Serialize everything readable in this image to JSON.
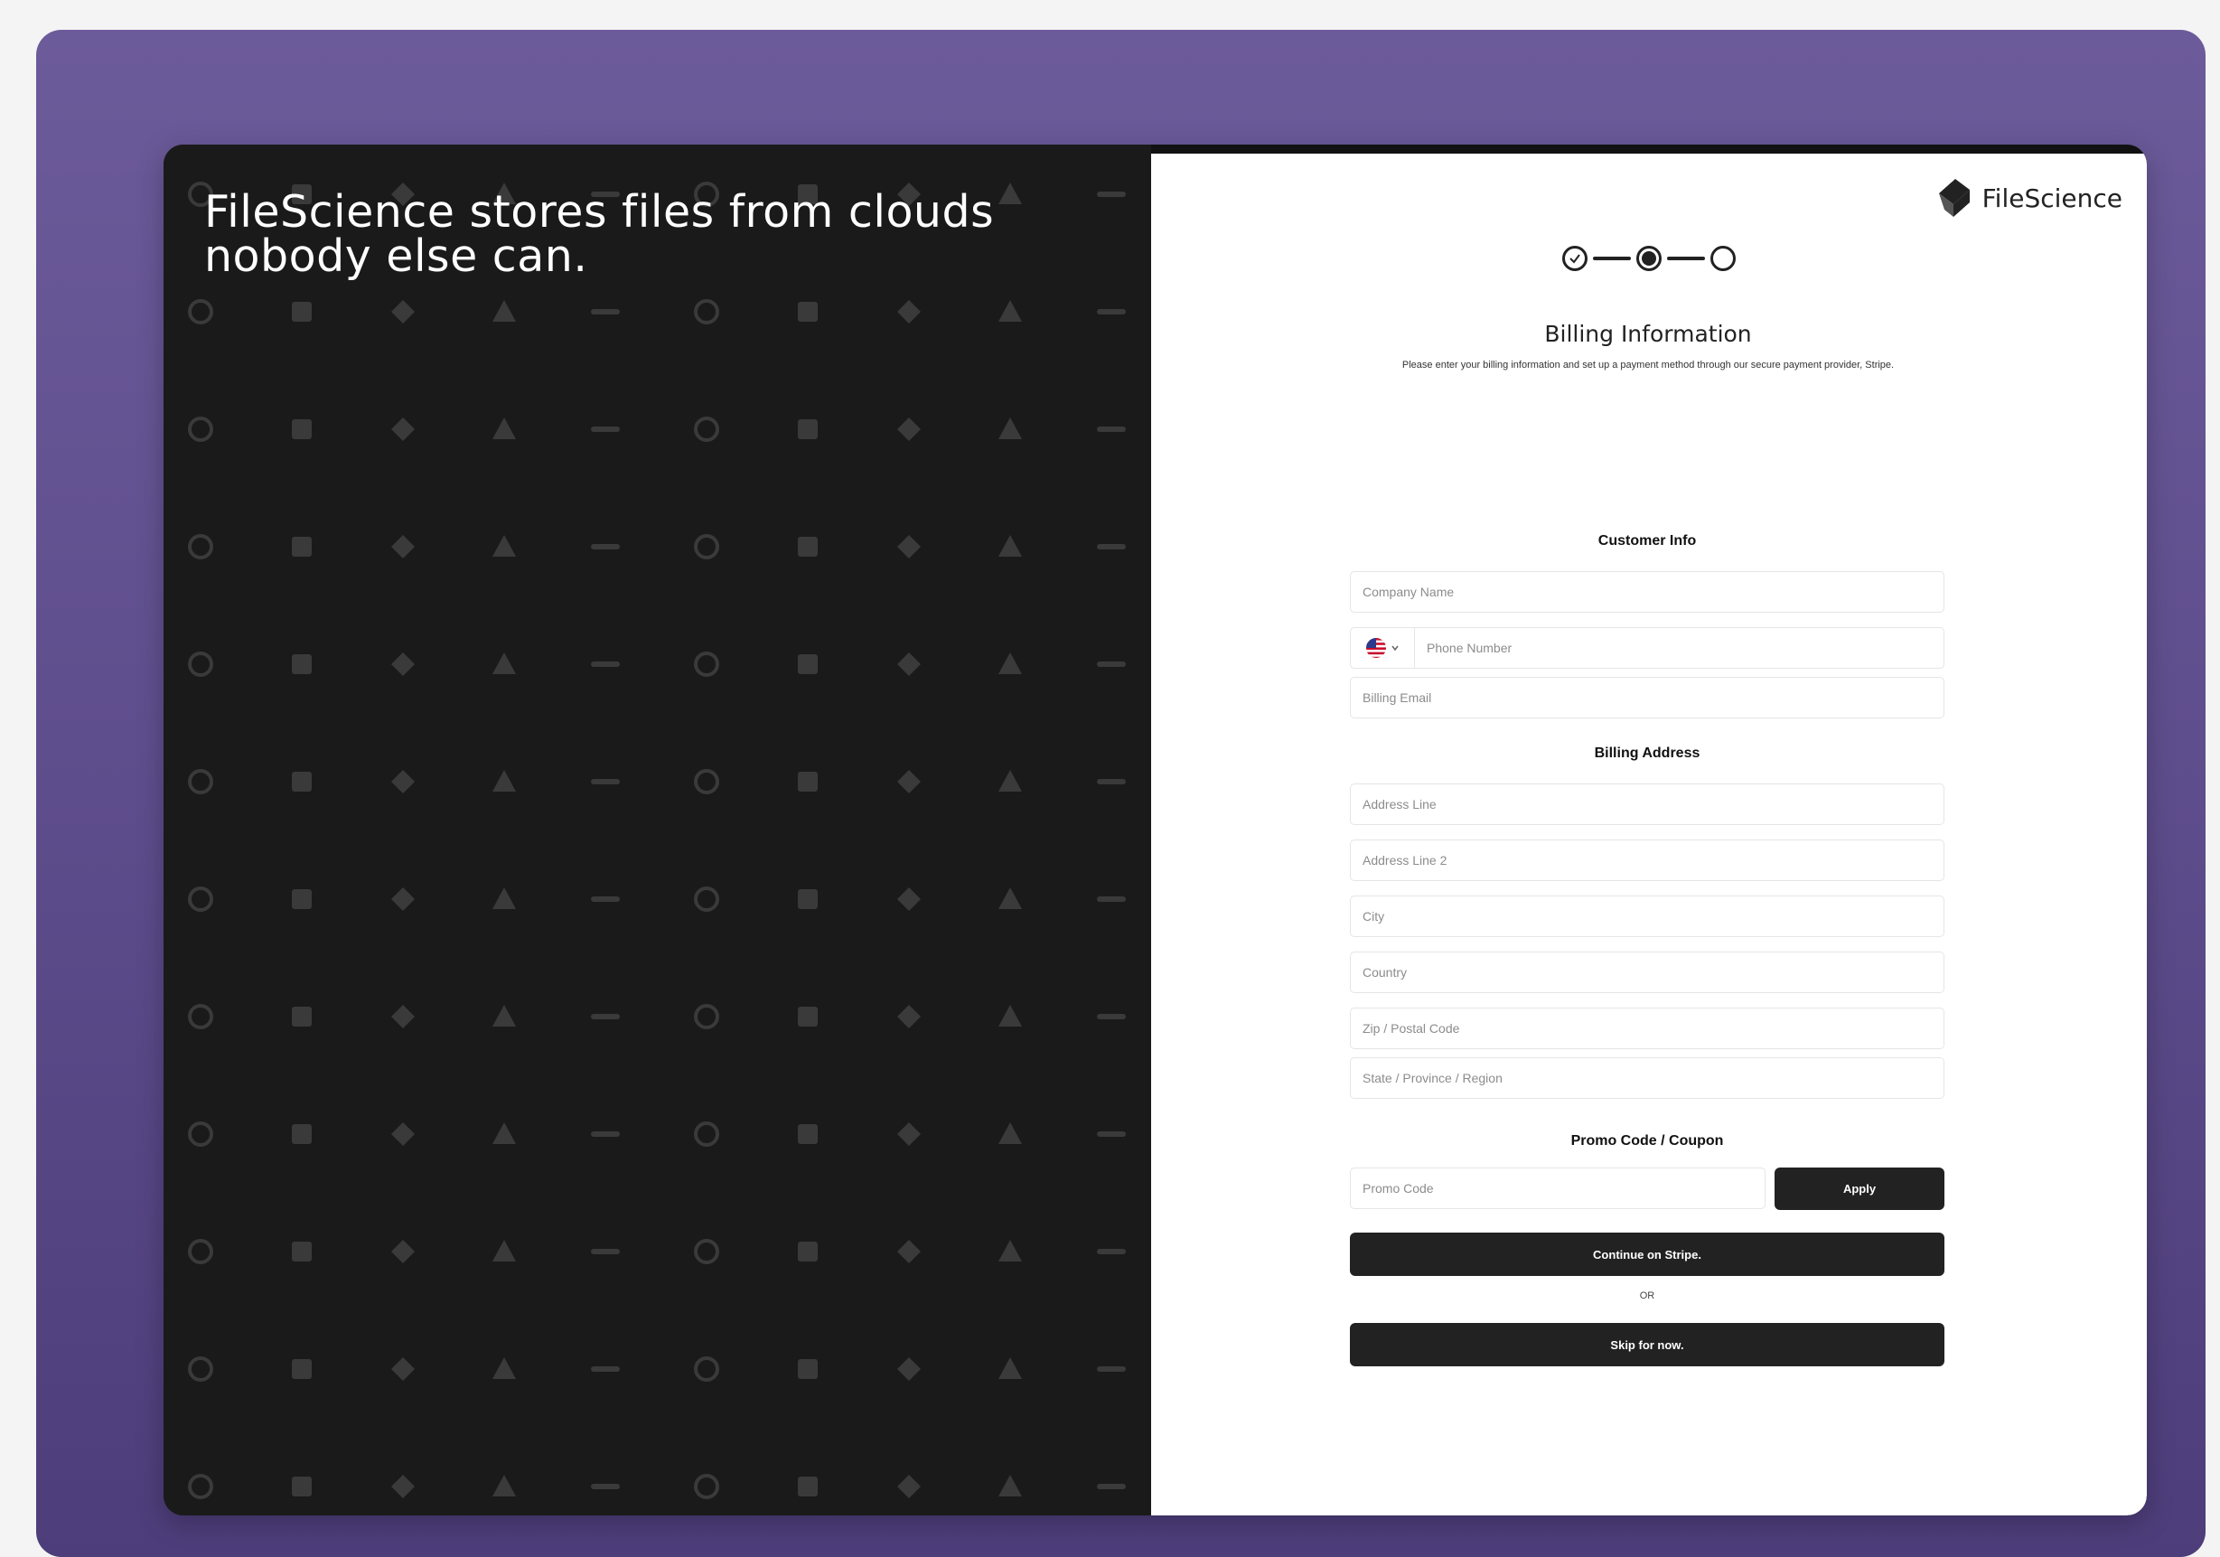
{
  "hero": {
    "headline_line1": "FileScience stores files from clouds",
    "headline_line2": "nobody else can."
  },
  "brand": {
    "name": "FileScience",
    "logo_icon": "filescience-logo-icon"
  },
  "stepper": {
    "steps": [
      "completed",
      "current",
      "upcoming"
    ]
  },
  "form": {
    "title": "Billing Information",
    "subtitle": "Please enter your billing information and set up a payment method through our secure payment provider, Stripe.",
    "customer_info": {
      "title": "Customer Info",
      "company_placeholder": "Company Name",
      "country_flag_icon": "us-flag-icon",
      "phone_placeholder": "Phone Number",
      "email_placeholder": "Billing Email"
    },
    "billing_address": {
      "title": "Billing Address",
      "address1_placeholder": "Address Line",
      "address2_placeholder": "Address Line 2",
      "city_placeholder": "City",
      "country_placeholder": "Country",
      "zip_placeholder": "Zip / Postal Code",
      "state_placeholder": "State / Province / Region"
    },
    "promo": {
      "title": "Promo Code / Coupon",
      "placeholder": "Promo Code",
      "apply_label": "Apply"
    },
    "continue_label": "Continue on Stripe.",
    "or_label": "OR",
    "skip_label": "Skip for now."
  },
  "colors": {
    "frame_purple": "#5e4d8c",
    "left_panel": "#1a1a1a",
    "button_dark": "#222222",
    "logo_gray": "#3a3a3a"
  },
  "logo_grid_icons": [
    "slack-icon",
    "opera-icon",
    "malt-icon",
    "adp-icon",
    "autodesk-icon",
    "zoom-icon",
    "confluence-icon",
    "asana-icon",
    "notion-icon",
    "dropbox-icon",
    "jira-icon",
    "ghost-icon",
    "magnet-icon",
    "cisco-icon",
    "gitlab-icon",
    "trello-icon",
    "workday-icon",
    "diamond-icon",
    "affinity-icon",
    "todoist-icon",
    "monday-icon",
    "analytics-icon",
    "box-icon",
    "nd-icon",
    "microsoft-icon",
    "google-icon",
    "check-icon",
    "check-circle-icon",
    "quickbooks-icon",
    "github-icon",
    "paypal-icon",
    "ifttt-icon",
    "figma-icon",
    "leap-icon",
    "pipedrive-icon"
  ]
}
